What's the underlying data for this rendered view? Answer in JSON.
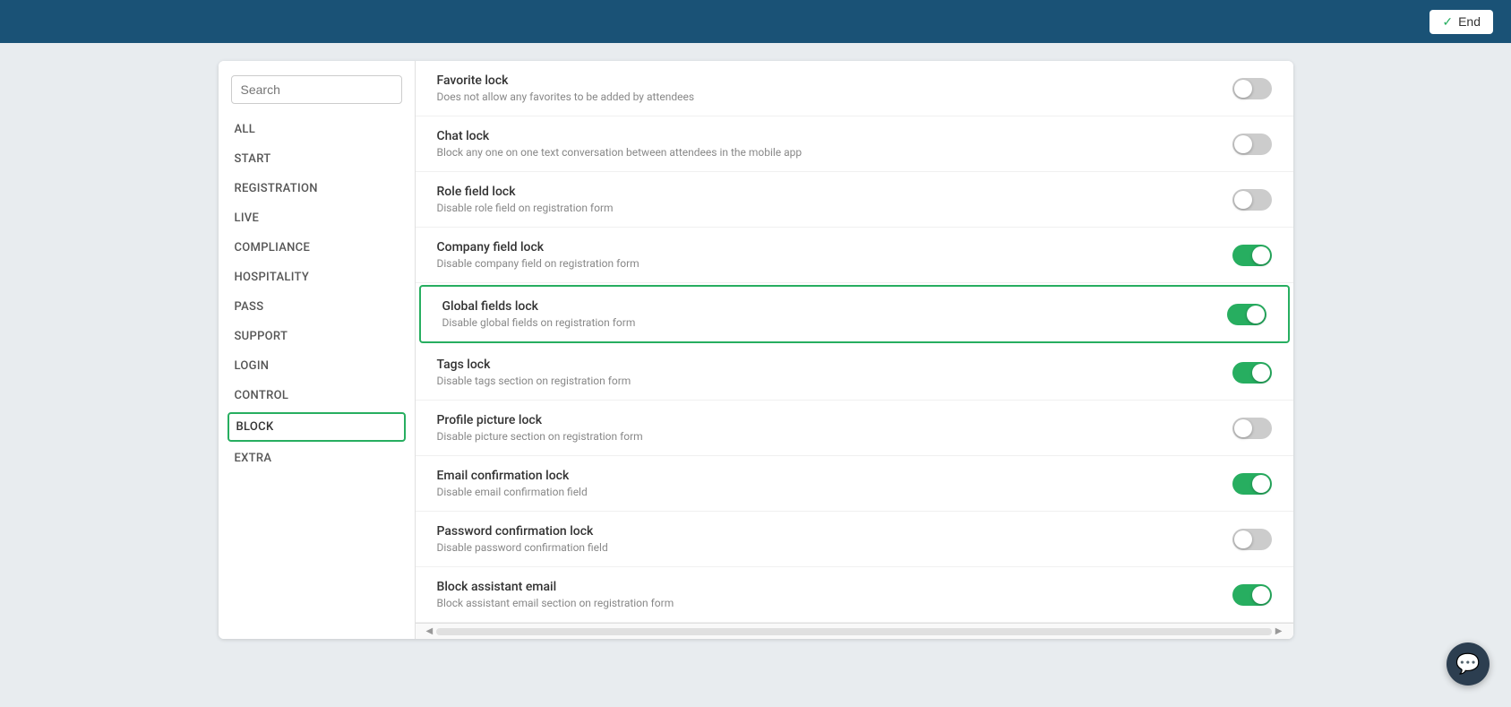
{
  "topbar": {
    "end_label": "End"
  },
  "sidebar": {
    "search_placeholder": "Search",
    "nav_items": [
      {
        "id": "all",
        "label": "ALL",
        "active": false
      },
      {
        "id": "start",
        "label": "START",
        "active": false
      },
      {
        "id": "registration",
        "label": "REGISTRATION",
        "active": false
      },
      {
        "id": "live",
        "label": "LIVE",
        "active": false
      },
      {
        "id": "compliance",
        "label": "COMPLIANCE",
        "active": false
      },
      {
        "id": "hospitality",
        "label": "HOSPITALITY",
        "active": false
      },
      {
        "id": "pass",
        "label": "PASS",
        "active": false
      },
      {
        "id": "support",
        "label": "SUPPORT",
        "active": false
      },
      {
        "id": "login",
        "label": "LOGIN",
        "active": false
      },
      {
        "id": "control",
        "label": "CONTROL",
        "active": false
      },
      {
        "id": "block",
        "label": "BLOCK",
        "active": true
      },
      {
        "id": "extra",
        "label": "EXTRA",
        "active": false
      }
    ]
  },
  "settings": [
    {
      "id": "favorite-lock",
      "title": "Favorite lock",
      "description": "Does not allow any favorites to be added by attendees",
      "enabled": false,
      "highlighted": false
    },
    {
      "id": "chat-lock",
      "title": "Chat lock",
      "description": "Block any one on one text conversation between attendees in the mobile app",
      "enabled": false,
      "highlighted": false
    },
    {
      "id": "role-field-lock",
      "title": "Role field lock",
      "description": "Disable role field on registration form",
      "enabled": false,
      "highlighted": false
    },
    {
      "id": "company-field-lock",
      "title": "Company field lock",
      "description": "Disable company field on registration form",
      "enabled": true,
      "highlighted": false
    },
    {
      "id": "global-fields-lock",
      "title": "Global fields lock",
      "description": "Disable global fields on registration form",
      "enabled": true,
      "highlighted": true
    },
    {
      "id": "tags-lock",
      "title": "Tags lock",
      "description": "Disable tags section on registration form",
      "enabled": true,
      "highlighted": false
    },
    {
      "id": "profile-picture-lock",
      "title": "Profile picture lock",
      "description": "Disable picture section on registration form",
      "enabled": false,
      "highlighted": false
    },
    {
      "id": "email-confirmation-lock",
      "title": "Email confirmation lock",
      "description": "Disable email confirmation field",
      "enabled": true,
      "highlighted": false
    },
    {
      "id": "password-confirmation-lock",
      "title": "Password confirmation lock",
      "description": "Disable password confirmation field",
      "enabled": false,
      "highlighted": false
    },
    {
      "id": "block-assistant-email",
      "title": "Block assistant email",
      "description": "Block assistant email section on registration form",
      "enabled": true,
      "highlighted": false
    }
  ],
  "colors": {
    "green": "#27ae60",
    "toggle_off": "#cccccc",
    "highlight_border": "#27ae60"
  }
}
